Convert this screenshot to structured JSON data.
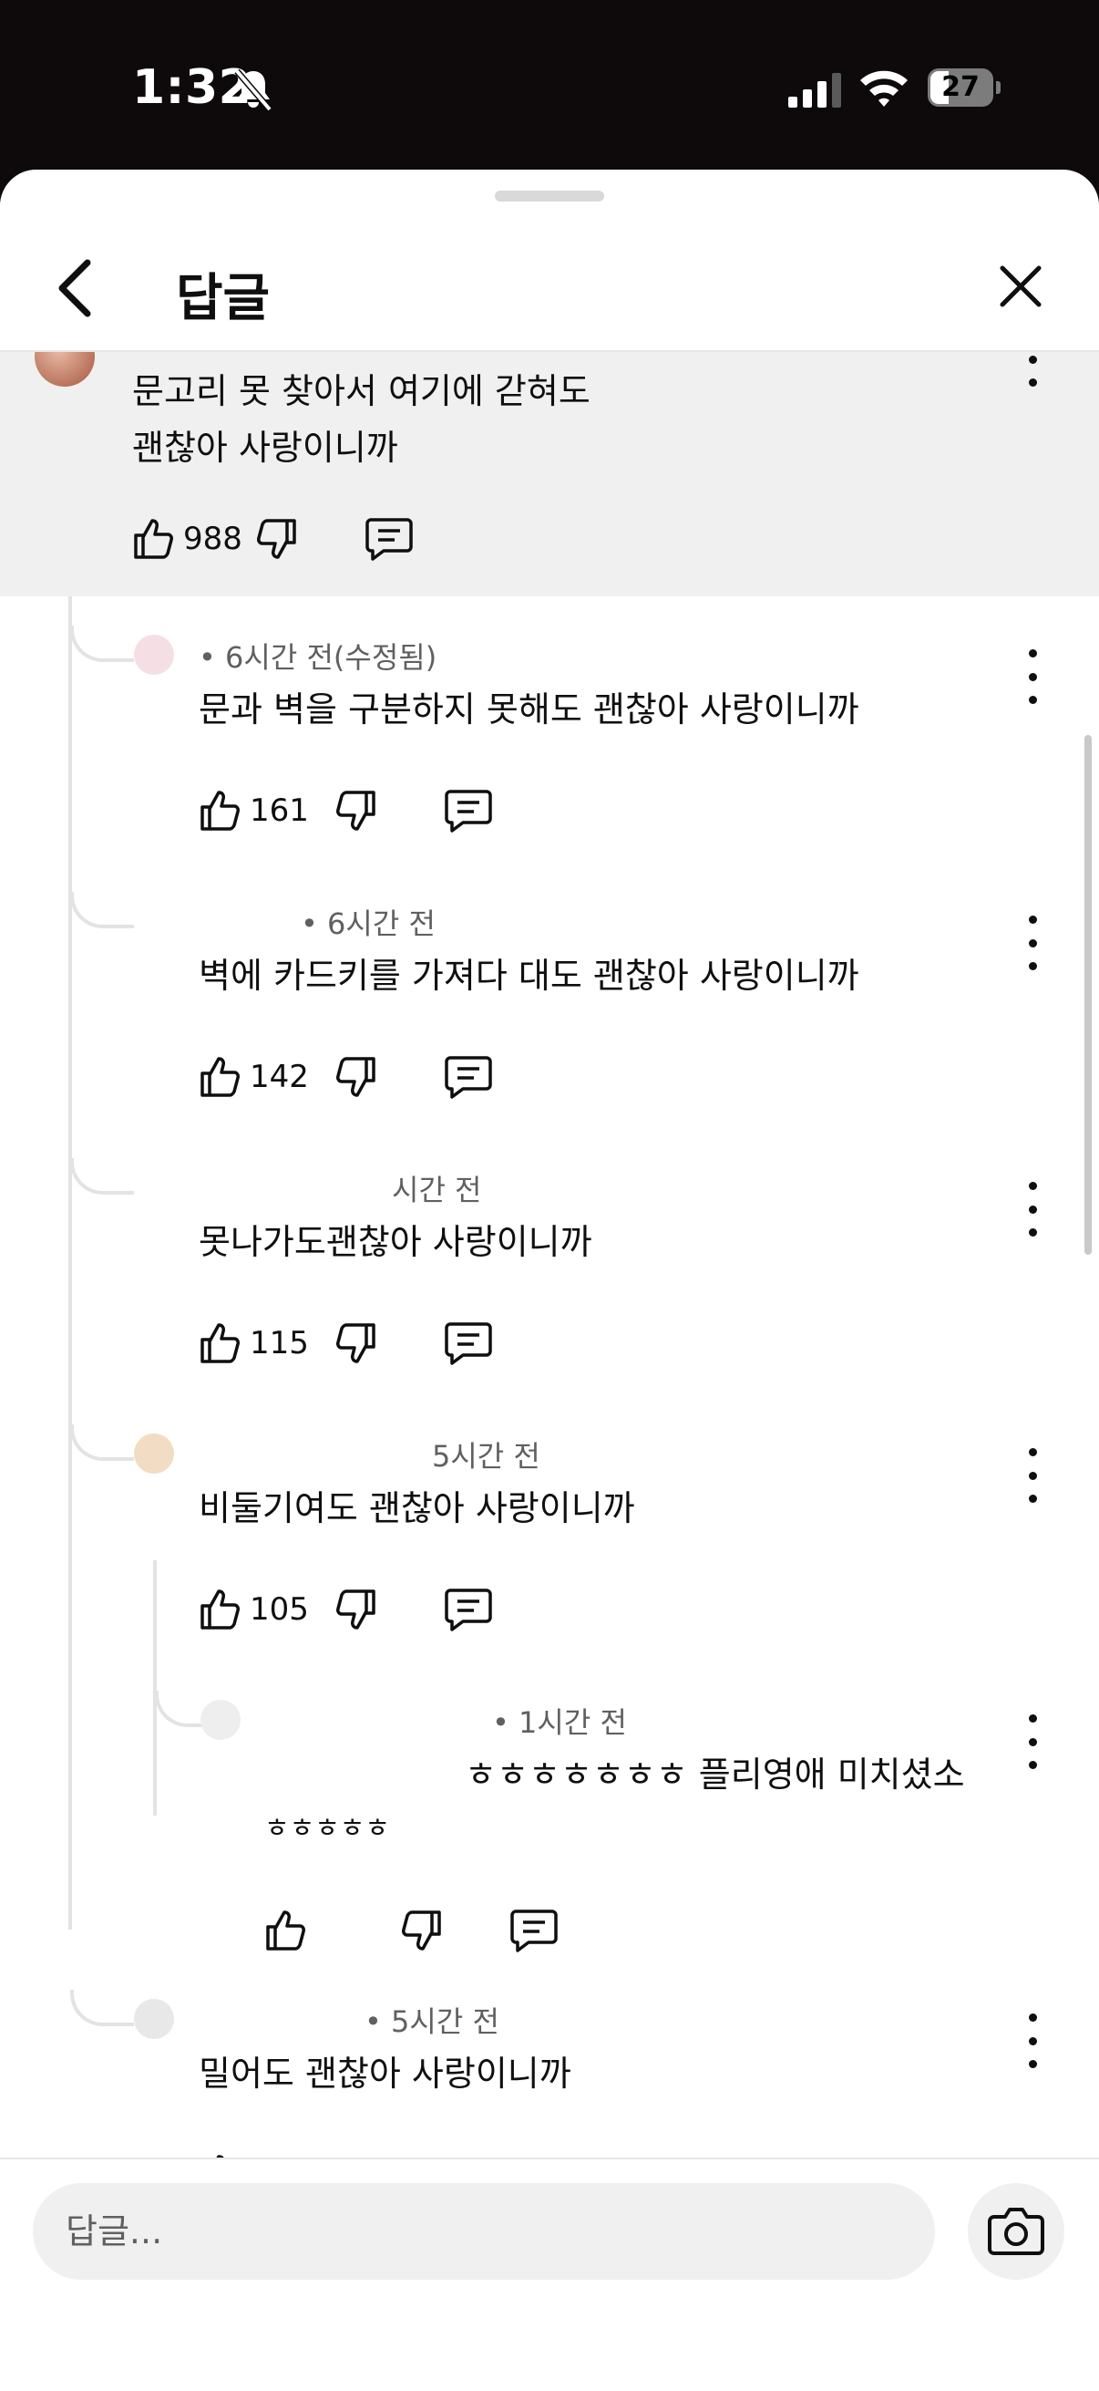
{
  "status_bar": {
    "time": "1:32",
    "battery": "27"
  },
  "header": {
    "title": "답글"
  },
  "parent_comment": {
    "line1": "문고리 못 찾아서 여기에 갇혀도",
    "line2": "괜찮아 사랑이니까",
    "likes": "988"
  },
  "replies": [
    {
      "meta": "• 6시간 전(수정됨)",
      "text": "문과 벽을 구분하지 못해도 괜찮아 사랑이니까",
      "likes": "161"
    },
    {
      "meta": "• 6시간 전",
      "text": "벽에 카드키를 가져다 대도 괜찮아 사랑이니까",
      "likes": "142"
    },
    {
      "meta": "시간 전",
      "text": "못나가도괜찮아 사랑이니까",
      "likes": "115"
    },
    {
      "meta": "5시간 전",
      "text": "비둘기여도 괜찮아 사랑이니까",
      "likes": "105"
    },
    {
      "meta": "• 1시간 전",
      "text": "ㅎㅎㅎㅎㅎㅎㅎ 플리영애 미치셨소",
      "text2": "ㅎㅎㅎㅎㅎ",
      "likes": ""
    },
    {
      "meta": "• 5시간 전",
      "text": "밀어도 괜찮아 사랑이니까",
      "likes": ""
    }
  ],
  "input": {
    "placeholder": "답글..."
  },
  "icons": [
    "bell-slash-icon",
    "signal-icon",
    "wifi-icon",
    "battery-icon",
    "back-arrow-icon",
    "close-icon",
    "like-icon",
    "dislike-icon",
    "reply-icon",
    "more-options-icon",
    "camera-icon"
  ]
}
